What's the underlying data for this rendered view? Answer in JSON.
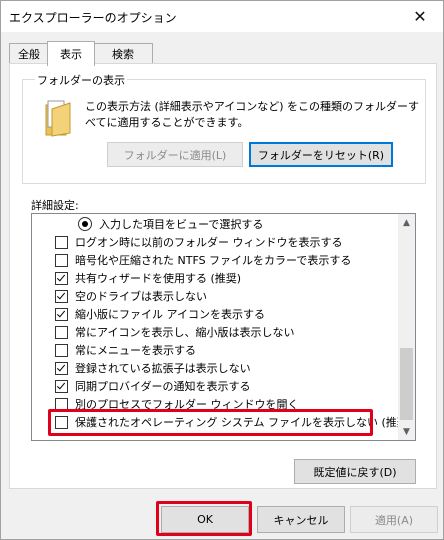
{
  "window": {
    "title": "エクスプローラーのオプション",
    "close_glyph": "✕"
  },
  "tabs": [
    {
      "label": "全般",
      "active": false
    },
    {
      "label": "表示",
      "active": true
    },
    {
      "label": "検索",
      "active": false
    }
  ],
  "folder_views": {
    "legend": "フォルダーの表示",
    "description": "この表示方法 (詳細表示やアイコンなど) をこの種類のフォルダーすべてに適用することができます。",
    "apply_button": "フォルダーに適用(L)",
    "reset_button": "フォルダーをリセット(R)"
  },
  "advanced": {
    "label": "詳細設定:",
    "items": [
      {
        "type": "radio",
        "checked": true,
        "label": "入力した項目をビューで選択する"
      },
      {
        "type": "checkbox",
        "checked": false,
        "label": "ログオン時に以前のフォルダー ウィンドウを表示する"
      },
      {
        "type": "checkbox",
        "checked": false,
        "label": "暗号化や圧縮された NTFS ファイルをカラーで表示する"
      },
      {
        "type": "checkbox",
        "checked": true,
        "label": "共有ウィザードを使用する (推奨)"
      },
      {
        "type": "checkbox",
        "checked": true,
        "label": "空のドライブは表示しない"
      },
      {
        "type": "checkbox",
        "checked": true,
        "label": "縮小版にファイル アイコンを表示する"
      },
      {
        "type": "checkbox",
        "checked": false,
        "label": "常にアイコンを表示し、縮小版は表示しない"
      },
      {
        "type": "checkbox",
        "checked": false,
        "label": "常にメニューを表示する"
      },
      {
        "type": "checkbox",
        "checked": true,
        "label": "登録されている拡張子は表示しない"
      },
      {
        "type": "checkbox",
        "checked": true,
        "label": "同期プロバイダーの通知を表示する"
      },
      {
        "type": "checkbox",
        "checked": false,
        "label": "別のプロセスでフォルダー ウィンドウを開く"
      },
      {
        "type": "checkbox",
        "checked": false,
        "label": "保護されたオペレーティング システム ファイルを表示しない (推奨)"
      }
    ],
    "restore_button": "既定値に戻す(D)"
  },
  "dialog_buttons": {
    "ok": "OK",
    "cancel": "キャンセル",
    "apply": "適用(A)"
  },
  "colors": {
    "highlight": "#e0001a",
    "focus": "#0078d7"
  },
  "icons": {
    "folder": "folder-icon",
    "close": "close-icon",
    "scroll_up": "scroll-up-icon",
    "scroll_down": "scroll-down-icon"
  }
}
